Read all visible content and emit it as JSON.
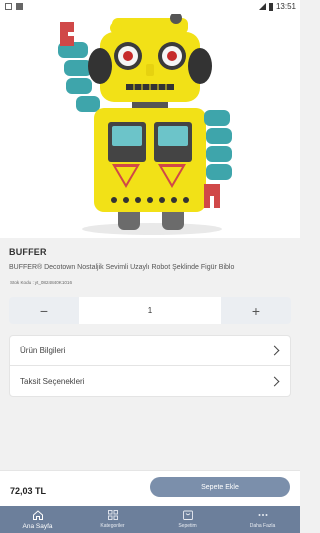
{
  "status_bar": {
    "time": "13:51"
  },
  "product": {
    "brand": "BUFFER",
    "title": "BUFFER® Decotown Nostaljik Sevimli Uzaylı Robot Şeklinde Figür Biblo",
    "sku_label": "Stok Kodu :",
    "sku_value": "yt_0824840K1016",
    "quantity": "1",
    "price": "72,03 TL"
  },
  "accordion": [
    {
      "label": "Ürün Bilgileri"
    },
    {
      "label": "Taksit Seçenekleri"
    }
  ],
  "actions": {
    "add_to_cart": "Sepete Ekle"
  },
  "nav": [
    {
      "label": "Ana Sayfa",
      "icon": "home-icon",
      "active": true
    },
    {
      "label": "Kategoriler",
      "icon": "grid-icon",
      "active": false
    },
    {
      "label": "Sepetim",
      "icon": "cart-icon",
      "active": false
    },
    {
      "label": "Daha Fazla",
      "icon": "more-icon",
      "active": false
    }
  ],
  "colors": {
    "nav_bg": "#6c7f9b",
    "button_bg": "#7b8fab",
    "robot_yellow": "#f2e117",
    "robot_teal": "#3ea5ab",
    "robot_red": "#c94a4a"
  }
}
